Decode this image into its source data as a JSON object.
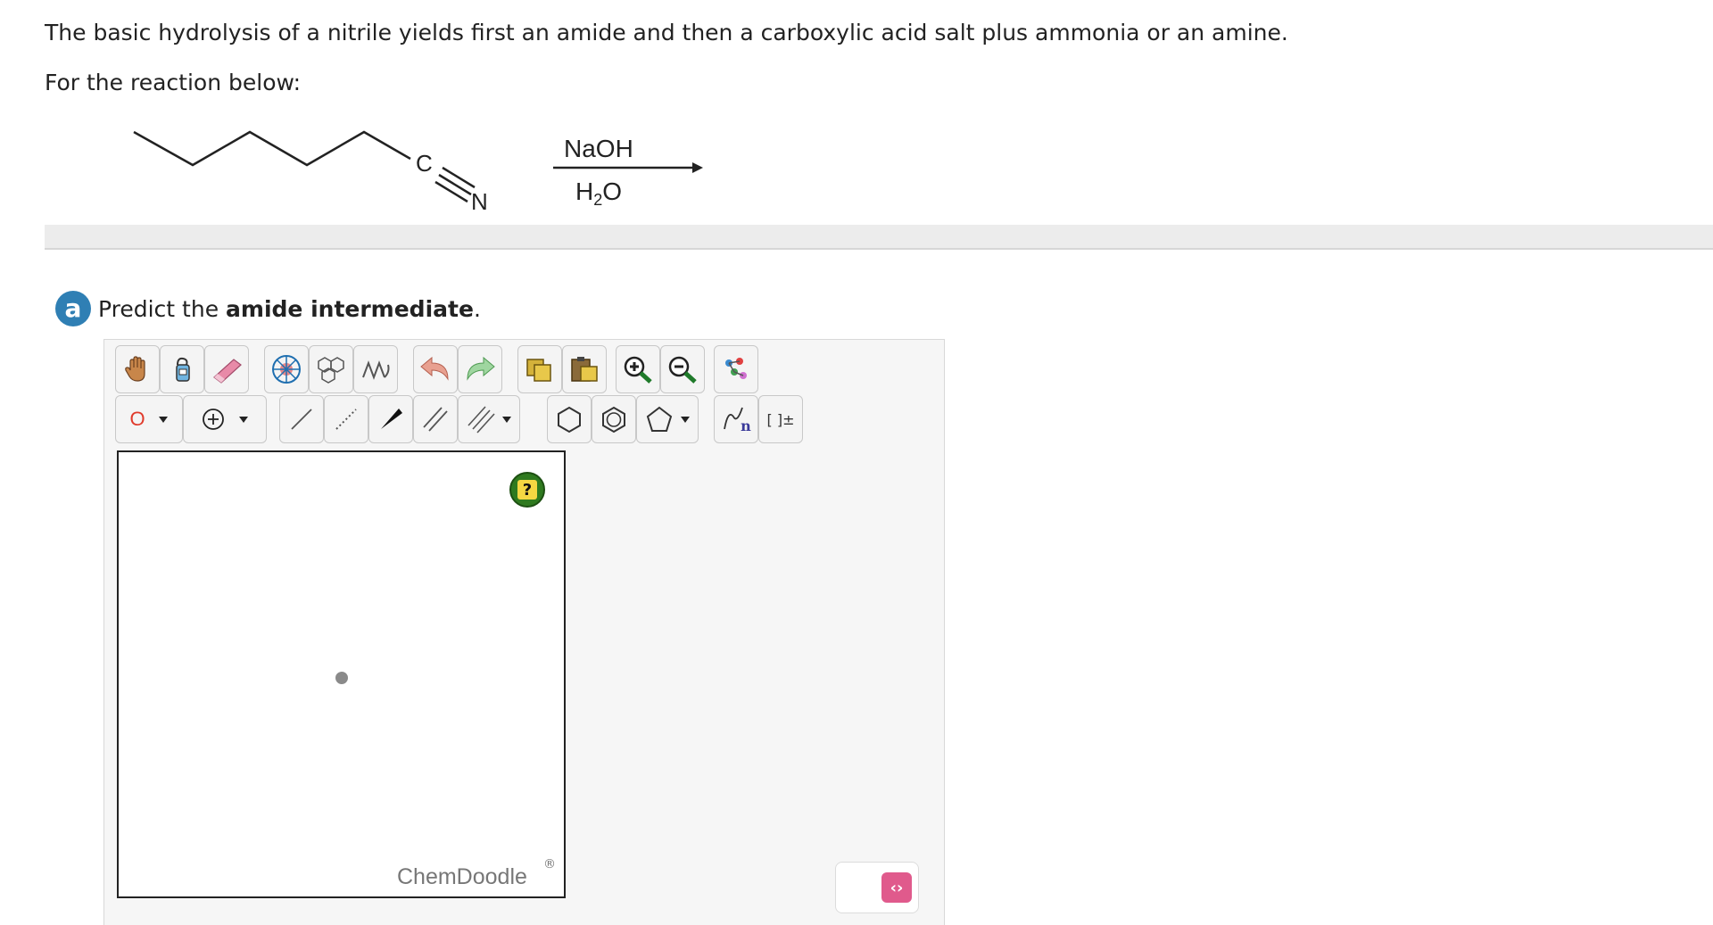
{
  "question": {
    "intro": "The basic hydrolysis of a nitrile yields first an amide and then a carboxylic acid salt plus ammonia or an amine.",
    "prompt": "For the reaction below:"
  },
  "reaction": {
    "atom_c": "C",
    "atom_n": "N",
    "reagent_top": "NaOH",
    "reagent_bottom_main": "H",
    "reagent_bottom_sub": "2",
    "reagent_bottom_end": "O"
  },
  "part_a": {
    "badge": "a",
    "text_before": "Predict the ",
    "text_bold": "amide intermediate",
    "text_after": "."
  },
  "editor": {
    "element_selector": "O",
    "help_label": "?",
    "brand": "ChemDoodle",
    "brand_mark": "®",
    "sgroup_label": "n",
    "charge_label": "[ ]±",
    "toggle_glyph": "‹›"
  },
  "colors": {
    "badge": "#2f7fb4",
    "help_button": "#2f7a1f",
    "toggle_button": "#e05a8c",
    "element_o": "#e03a2b"
  }
}
